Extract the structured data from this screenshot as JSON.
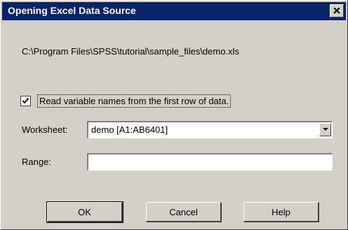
{
  "window": {
    "title": "Opening Excel Data Source",
    "close_icon": "close-icon"
  },
  "file_path": "C:\\Program Files\\SPSS\\tutorial\\sample_files\\demo.xls",
  "read_names": {
    "checked": true,
    "label": "Read variable names from the first row of data."
  },
  "worksheet": {
    "label": "Worksheet:",
    "value": "demo  [A1:AB6401]"
  },
  "range": {
    "label": "Range:",
    "value": ""
  },
  "buttons": {
    "ok": "OK",
    "cancel": "Cancel",
    "help": "Help"
  }
}
